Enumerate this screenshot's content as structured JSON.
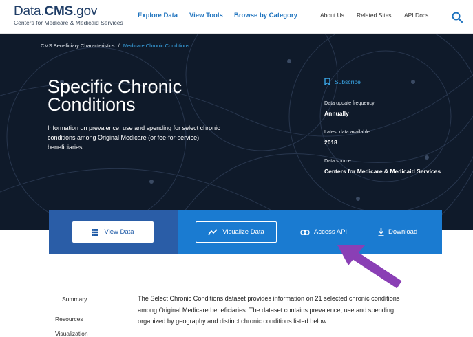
{
  "header": {
    "logo_prefix": "Data.",
    "logo_bold": "CMS",
    "logo_suffix": ".gov",
    "logo_sub": "Centers for Medicare & Medicaid Services",
    "nav_primary": [
      "Explore Data",
      "View Tools",
      "Browse by Category"
    ],
    "nav_secondary": [
      "About Us",
      "Related Sites",
      "API Docs"
    ],
    "search_icon": "search-icon"
  },
  "hero": {
    "breadcrumb_parent": "CMS Beneficiary Characteristics",
    "breadcrumb_sep": "/",
    "breadcrumb_current": "Medicare Chronic Conditions",
    "title": "Specific Chronic Conditions",
    "description": "Information on prevalence, use and spending for select chronic conditions among Original Medicare (or fee-for-service) beneficiaries.",
    "subscribe_label": "Subscribe",
    "meta": [
      {
        "label": "Data update frequency",
        "value": "Annually"
      },
      {
        "label": "Latest data available",
        "value": "2018"
      },
      {
        "label": "Data source",
        "value": "Centers for Medicare & Medicaid Services"
      }
    ]
  },
  "actions": {
    "view_data": "View Data",
    "visualize_data": "Visualize Data",
    "access_api": "Access API",
    "download": "Download"
  },
  "toc": [
    "Summary",
    "Resources",
    "Visualization"
  ],
  "intro": "The Select Chronic Conditions dataset provides information on 21 selected chronic conditions among Original Medicare beneficiaries. The dataset contains prevalence, use and spending organized by geography and distinct chronic conditions listed below.",
  "colors": {
    "brand_blue": "#1e73be",
    "hero_bg": "#0f1a2a",
    "action_bar": "#1a7bd1",
    "action_left": "#2a5da7",
    "annotation_arrow": "#8a3fb5"
  }
}
